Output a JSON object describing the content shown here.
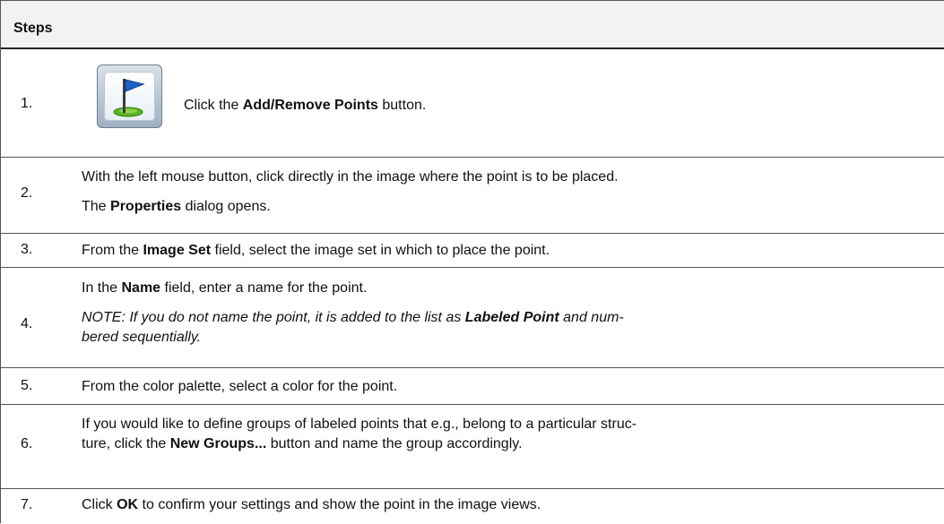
{
  "header": {
    "title": "Steps"
  },
  "steps": [
    {
      "num": "1.",
      "parts": [
        "Click the ",
        "Add/Remove Points",
        " button."
      ]
    },
    {
      "num": "2.",
      "line1": "With the left mouse button, click directly in the image where the point is to be placed.",
      "line2_parts": [
        "The ",
        "Properties",
        " dialog opens."
      ]
    },
    {
      "num": "3.",
      "parts": [
        "From the ",
        "Image Set",
        " field, select the image set in which to place the point."
      ]
    },
    {
      "num": "4.",
      "line1_parts": [
        "In the ",
        "Name",
        " field, enter a name for the point."
      ],
      "note_parts": [
        "NOTE: If you do not name the point, it is added to the list as ",
        "Labeled Point",
        " and num-"
      ],
      "note_line2": "bered sequentially."
    },
    {
      "num": "5.",
      "text": "From the color palette, select a color for the point."
    },
    {
      "num": "6.",
      "line1": "If you would like to define groups of labeled points that e.g., belong to a particular struc-",
      "line2_parts": [
        "ture, click the ",
        "New Groups...",
        " button and name the group accordingly."
      ]
    },
    {
      "num": "7.",
      "parts": [
        "Click ",
        "OK",
        " to confirm your settings and show the point in the image views."
      ]
    }
  ],
  "icons": {
    "step1": "flag-icon"
  },
  "colors": {
    "header_bg": "#f2f2f2",
    "flag_blue": "#1e63c8",
    "flag_green": "#5ab41e"
  }
}
